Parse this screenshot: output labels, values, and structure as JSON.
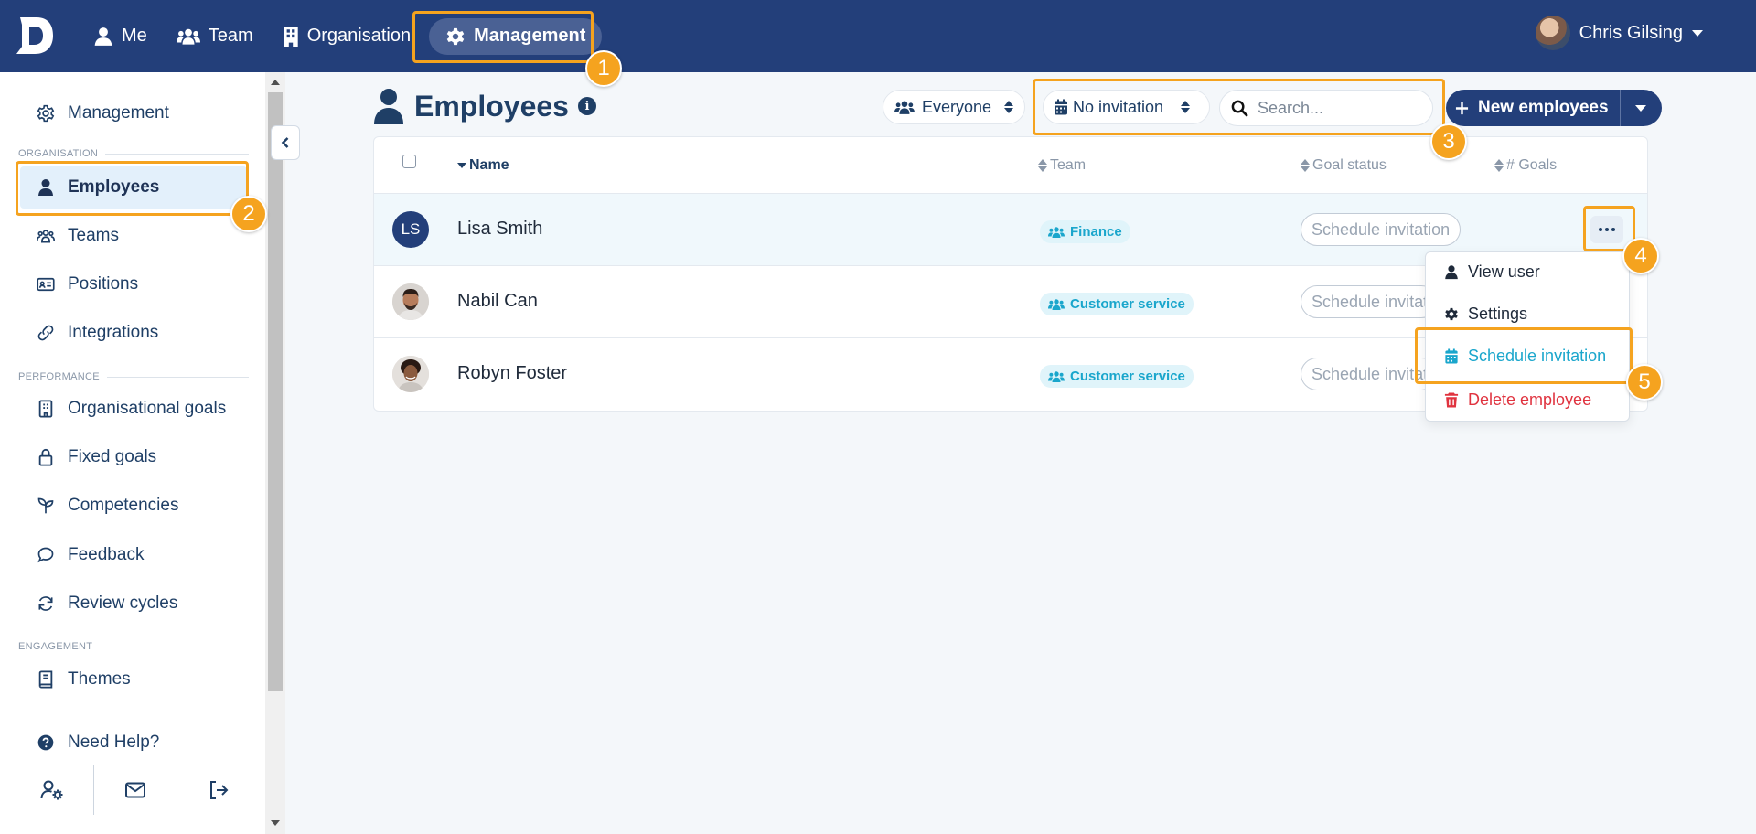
{
  "nav": {
    "logo_letter": "D",
    "items": [
      {
        "label": "Me",
        "icon": "person-icon"
      },
      {
        "label": "Team",
        "icon": "people-icon"
      },
      {
        "label": "Organisation",
        "icon": "building-icon"
      },
      {
        "label": "Management",
        "icon": "gear-icon",
        "active": true
      }
    ],
    "user_name": "Chris Gilsing"
  },
  "sidebar": {
    "top_item": "Management",
    "sections": {
      "organisation": "ORGANISATION",
      "performance": "PERFORMANCE",
      "engagement": "ENGAGEMENT"
    },
    "items": {
      "employees": "Employees",
      "teams": "Teams",
      "positions": "Positions",
      "integrations": "Integrations",
      "organisational_goals": "Organisational goals",
      "fixed_goals": "Fixed goals",
      "competencies": "Competencies",
      "feedback": "Feedback",
      "review_cycles": "Review cycles",
      "themes": "Themes",
      "need_help": "Need Help?"
    }
  },
  "main": {
    "title": "Employees",
    "filters": {
      "audience": "Everyone",
      "invitation": "No invitation"
    },
    "search_placeholder": "Search...",
    "new_button": "New employees",
    "columns": {
      "name": "Name",
      "team": "Team",
      "goal_status": "Goal status",
      "goals": "# Goals"
    },
    "rows": [
      {
        "initials": "LS",
        "name": "Lisa Smith",
        "team": "Finance",
        "action": "Schedule invitation"
      },
      {
        "name": "Nabil Can",
        "team": "Customer service",
        "action": "Schedule invitation"
      },
      {
        "name": "Robyn Foster",
        "team": "Customer service",
        "action": "Schedule invitation"
      }
    ]
  },
  "dropdown": {
    "view_user": "View user",
    "settings": "Settings",
    "schedule_invitation": "Schedule invitation",
    "delete_employee": "Delete employee"
  },
  "annotations": [
    "1",
    "2",
    "3",
    "4",
    "5"
  ],
  "colors": {
    "topbar": "#233f7a",
    "highlight": "#f5a31f",
    "accent_cyan": "#1aa6cc",
    "danger": "#e0333f"
  }
}
